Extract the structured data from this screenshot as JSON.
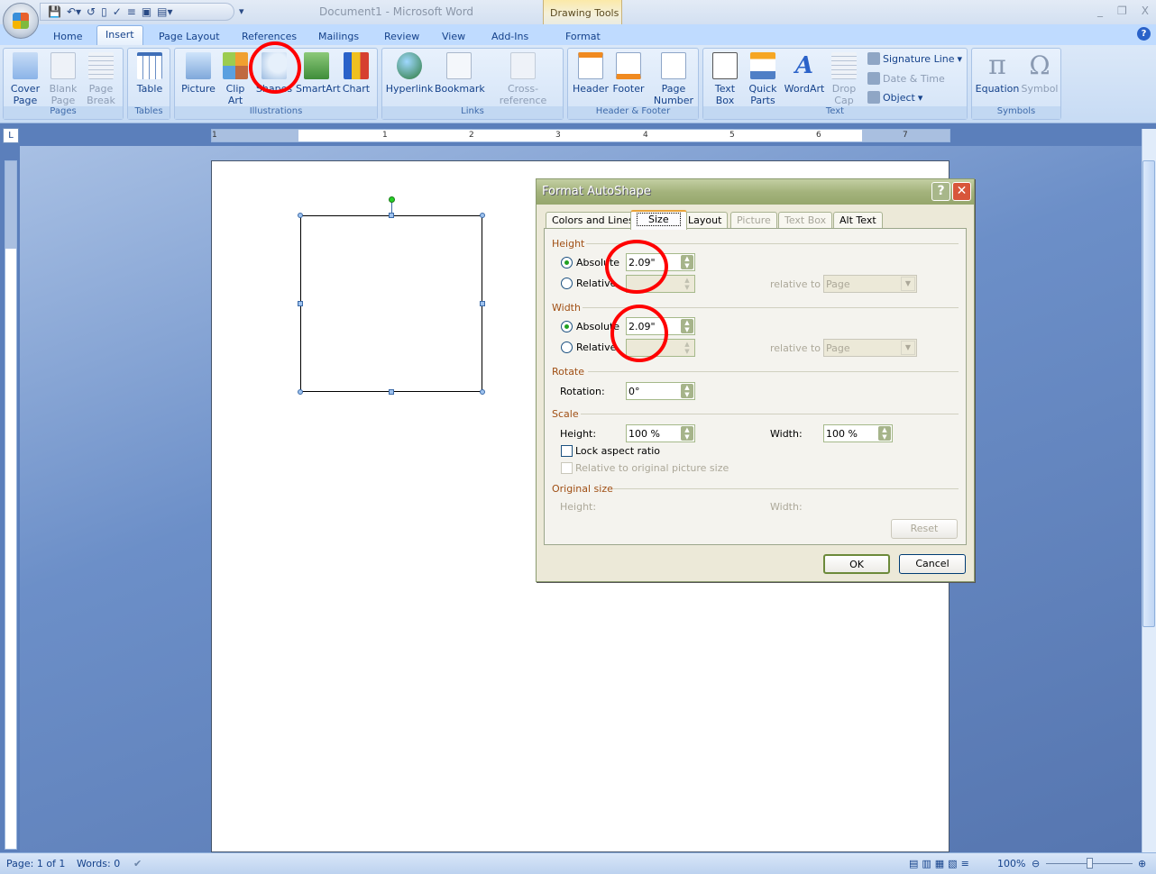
{
  "window": {
    "title": "Document1  -  Microsoft Word",
    "contextual_tab": "Drawing Tools",
    "min": "_",
    "max": "❐",
    "close": "X"
  },
  "tabs": [
    "Home",
    "Insert",
    "Page Layout",
    "References",
    "Mailings",
    "Review",
    "View",
    "Add-Ins",
    "Format"
  ],
  "ribbon": {
    "pages": {
      "label": "Pages",
      "cover": "Cover Page",
      "blank": "Blank Page",
      "break": "Page Break"
    },
    "tables": {
      "label": "Tables",
      "table": "Table"
    },
    "illustrations": {
      "label": "Illustrations",
      "picture": "Picture",
      "clipart": "Clip Art",
      "shapes": "Shapes",
      "smartart": "SmartArt",
      "chart": "Chart"
    },
    "links": {
      "label": "Links",
      "hyperlink": "Hyperlink",
      "bookmark": "Bookmark",
      "crossref": "Cross-reference"
    },
    "headerfooter": {
      "label": "Header & Footer",
      "header": "Header",
      "footer": "Footer",
      "pagenum": "Page Number"
    },
    "text": {
      "label": "Text",
      "textbox": "Text Box",
      "quickparts": "Quick Parts",
      "wordart": "WordArt",
      "dropcap": "Drop Cap",
      "signature": "Signature Line",
      "datetime": "Date & Time",
      "object": "Object"
    },
    "symbols": {
      "label": "Symbols",
      "equation": "Equation",
      "symbol": "Symbol"
    }
  },
  "ruler": {
    "corner": "L",
    "numbers": [
      "1",
      "1",
      "2",
      "3",
      "4",
      "5",
      "6",
      "7"
    ]
  },
  "dialog": {
    "title": "Format AutoShape",
    "help": "?",
    "close": "✕",
    "tabs": [
      "Colors and Lines",
      "Size",
      "Layout",
      "Picture",
      "Text Box",
      "Alt Text"
    ],
    "height_section": "Height",
    "width_section": "Width",
    "rotate_section": "Rotate",
    "scale_section": "Scale",
    "original_section": "Original size",
    "absolute": "Absolute",
    "relative": "Relative",
    "relative_to": "relative to",
    "page_option": "Page",
    "height_abs": "2.09\"",
    "width_abs": "2.09\"",
    "rotation_label": "Rotation:",
    "rotation": "0°",
    "scale_height_label": "Height:",
    "scale_height": "100 %",
    "scale_width_label": "Width:",
    "scale_width": "100 %",
    "lock_aspect": "Lock aspect ratio",
    "relative_original": "Relative to original picture size",
    "orig_height": "Height:",
    "orig_width": "Width:",
    "reset": "Reset",
    "ok": "OK",
    "cancel": "Cancel"
  },
  "status": {
    "page": "Page: 1 of 1",
    "words": "Words: 0",
    "zoom": "100%"
  },
  "colors": {
    "annotation": "#ff0000",
    "accent": "#15428b"
  }
}
